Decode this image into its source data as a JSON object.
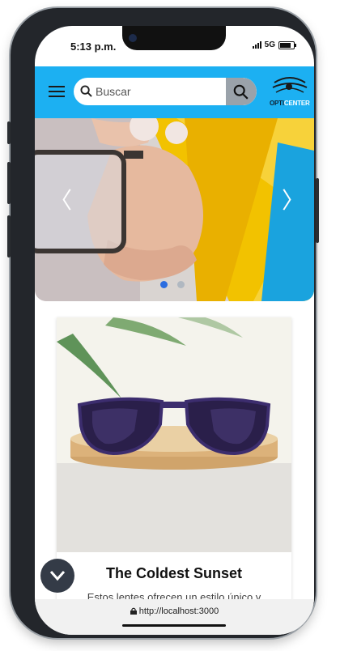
{
  "status_bar": {
    "time": "5:13 p.m.",
    "network": "5G"
  },
  "header": {
    "search_placeholder": "Buscar",
    "logo": {
      "part1": "OPTI",
      "part2": "CENTER"
    }
  },
  "banner": {
    "prev_arrow": "〈",
    "next_arrow": "〉",
    "slides": 2,
    "active_slide": 1
  },
  "product": {
    "title": "The Coldest Sunset",
    "description": "Estos lentes ofrecen un estilo único y"
  },
  "browser": {
    "url": "http://localhost:3000"
  },
  "colors": {
    "header_bg": "#1cb0f2",
    "accent": "#f2c200",
    "active_dot": "#2b6de0"
  }
}
